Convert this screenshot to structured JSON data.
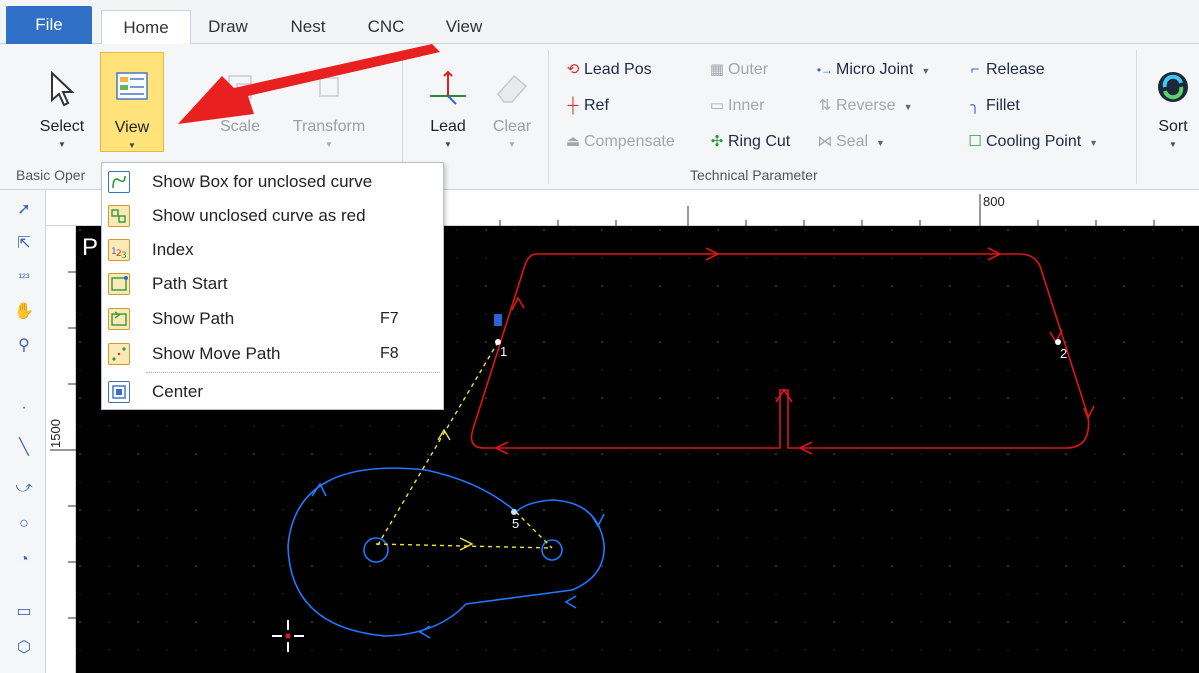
{
  "tabs": [
    "File",
    "Home",
    "Draw",
    "Nest",
    "CNC",
    "View"
  ],
  "ribbon": {
    "basic": {
      "label": "Basic Oper",
      "select": "Select",
      "view": "View",
      "scale": "Scale",
      "transform": "Transform"
    },
    "lead": "Lead",
    "clear": "Clear",
    "tech": {
      "label": "Technical Parameter",
      "lead_pos": "Lead Pos",
      "ref": "Ref",
      "compensate": "Compensate",
      "outer": "Outer",
      "inner": "Inner",
      "ring_cut": "Ring Cut",
      "micro_joint": "Micro Joint",
      "reverse": "Reverse",
      "seal": "Seal",
      "release": "Release",
      "fillet": "Fillet",
      "cooling_point": "Cooling Point"
    },
    "sort": "Sort"
  },
  "view_menu": {
    "items": [
      {
        "label": "Show Box for unclosed curve",
        "key": ""
      },
      {
        "label": "Show unclosed curve as red",
        "key": ""
      },
      {
        "label": "Index",
        "key": ""
      },
      {
        "label": "Path Start",
        "key": ""
      },
      {
        "label": "Show Path",
        "key": "F7"
      },
      {
        "label": "Show Move Path",
        "key": "F8"
      },
      {
        "label": "Center",
        "key": ""
      }
    ]
  },
  "rulers": {
    "h_label": "800",
    "v_label": "1500"
  },
  "canvas": {
    "corner_text": "P",
    "markers": [
      "1",
      "2",
      "5"
    ]
  },
  "colors": {
    "accent": "#2f6fc6",
    "active_button": "#ffe27a",
    "red_part": "#e01515",
    "blue_part": "#1f78ff",
    "move_path": "#f2e23a",
    "arrow": "#e82020"
  }
}
